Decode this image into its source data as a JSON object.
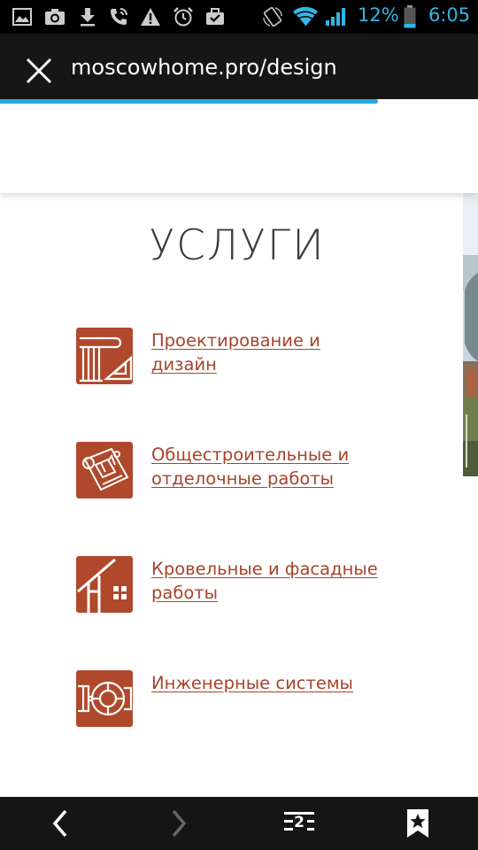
{
  "status_bar": {
    "icons": [
      "gallery-icon",
      "camera-icon",
      "download-icon",
      "call-icon",
      "warning-icon",
      "alarm-icon",
      "briefcase-icon",
      "rotation-icon",
      "wifi-icon",
      "signal-icon",
      "battery-icon"
    ],
    "battery_percent": "12%",
    "time": "6:05",
    "accent_color": "#33b5e5"
  },
  "browser": {
    "url": "moscowhome.pro/design",
    "load_progress": 0.79
  },
  "page": {
    "title": "УСЛУГИ",
    "accent_color": "#b0492c",
    "services": [
      {
        "label": "Проектирование и дизайн",
        "icon": "column-design-icon"
      },
      {
        "label": "Общестроительные и отделочные работы",
        "icon": "blueprint-icon"
      },
      {
        "label": "Кровельные и фасадные работы",
        "icon": "roof-icon"
      },
      {
        "label": "Инженерные системы",
        "icon": "engineering-icon"
      }
    ]
  },
  "nav": {
    "tab_count": "2"
  }
}
